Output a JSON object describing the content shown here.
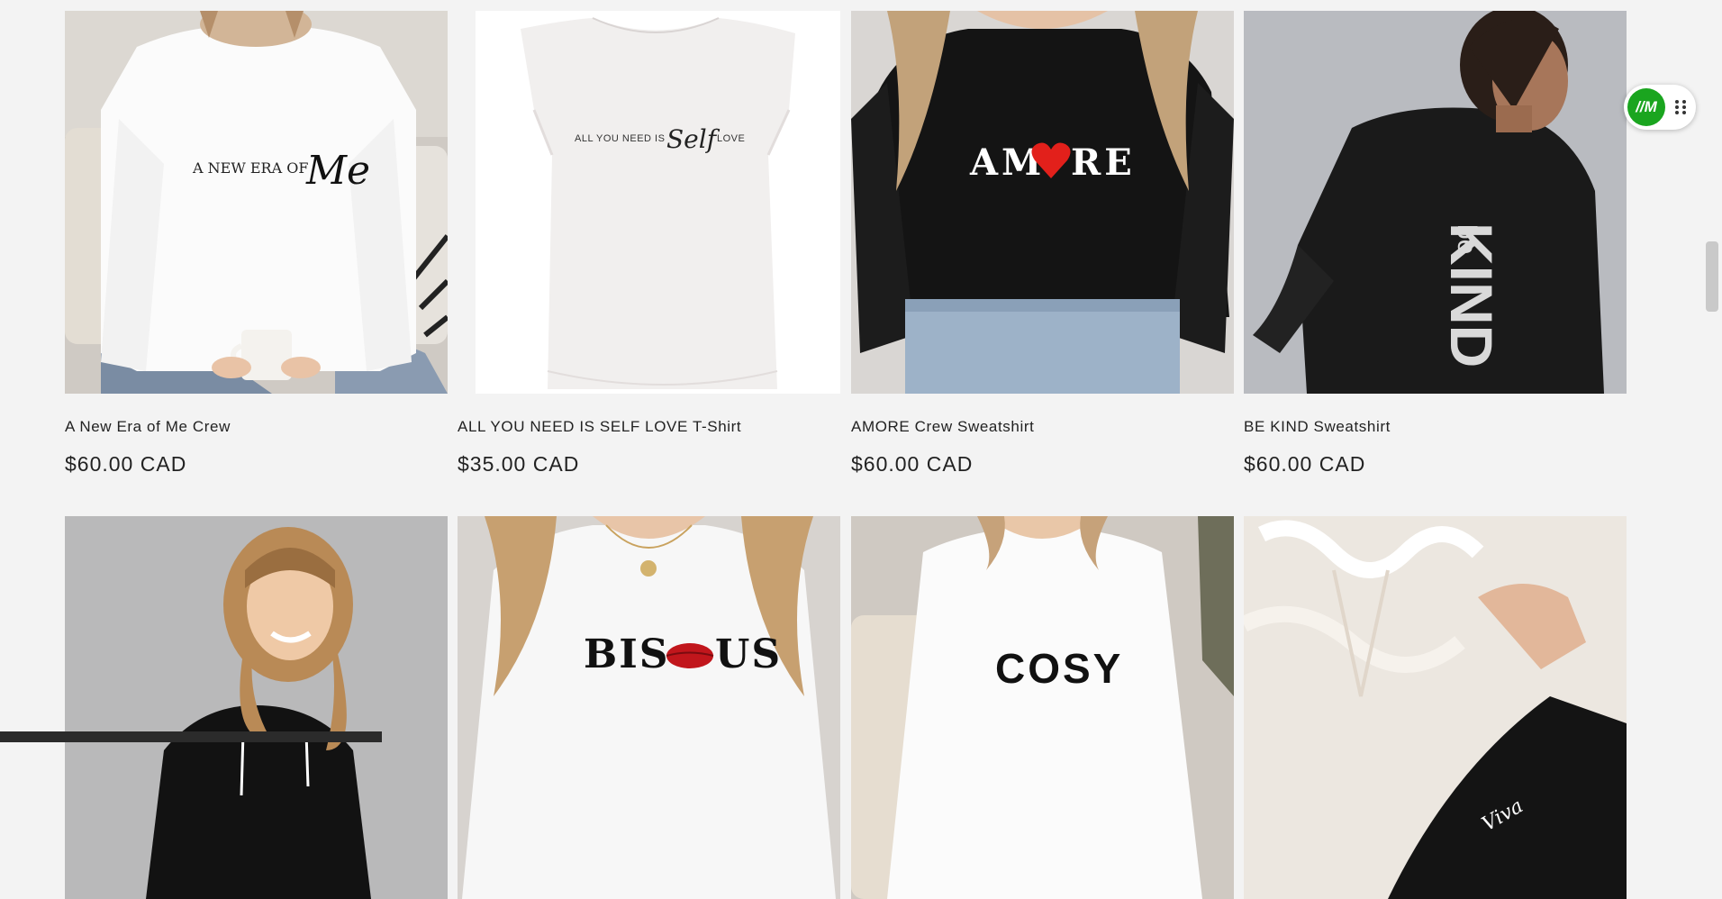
{
  "products": [
    {
      "title": "A New Era of Me Crew",
      "price": "$60.00 CAD",
      "print_parts": [
        "A NEW ERA OF",
        "Me"
      ]
    },
    {
      "title": "ALL YOU NEED IS SELF LOVE T-Shirt",
      "price": "$35.00 CAD",
      "print_parts": [
        "ALL YOU NEED IS",
        "Self",
        "LOVE"
      ]
    },
    {
      "title": "AMORE Crew Sweatshirt",
      "price": "$60.00 CAD",
      "print_parts": [
        "AM",
        "RE"
      ]
    },
    {
      "title": "BE KIND Sweatshirt",
      "price": "$60.00 CAD",
      "print_parts": [
        "be",
        "KIND"
      ]
    },
    {
      "print_parts": []
    },
    {
      "print_parts": [
        "BIS",
        "US"
      ]
    },
    {
      "print_parts": [
        "COSY"
      ]
    },
    {
      "print_parts": [
        "Viva"
      ]
    }
  ],
  "widget": {
    "badge_label": "//M",
    "icon": "drag-handle-icon"
  },
  "colors": {
    "background": "#f3f3f3",
    "widget_green": "#1aa51f",
    "amore_heart": "#e2201b",
    "bisous_lips": "#c1161c"
  }
}
